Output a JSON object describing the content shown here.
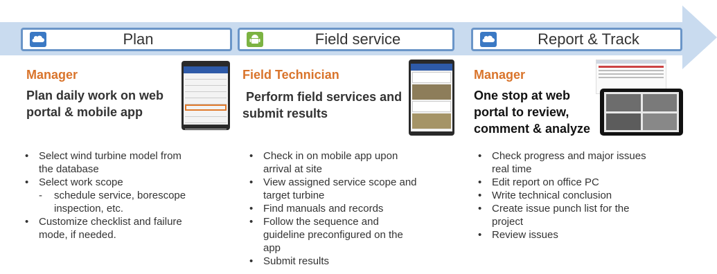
{
  "colors": {
    "accent": "#d9742b",
    "frame": "#6a95c8",
    "arrow": "#c9dbef"
  },
  "stages": [
    {
      "title": "Plan",
      "icon": "cloud-icon",
      "role": "Manager",
      "summary_lines": [
        "Plan daily work on web",
        "portal & mobile app"
      ],
      "bullets": [
        {
          "lines": [
            "Select wind turbine model from",
            "the database"
          ]
        },
        {
          "lines": [
            "Select work scope"
          ]
        },
        {
          "lines": [
            "schedule service, borescope",
            "inspection,  etc."
          ],
          "sub": true
        },
        {
          "lines": [
            "Customize checklist and failure",
            "mode, if needed."
          ]
        }
      ]
    },
    {
      "title": "Field service",
      "icon": "android-icon",
      "role": "Field Technician",
      "summary_lines": [
        " Perform field services and",
        "submit results"
      ],
      "bullets": [
        {
          "lines": [
            "Check in on mobile app upon",
            "arrival at site"
          ]
        },
        {
          "lines": [
            "View assigned service scope and",
            "target turbine"
          ]
        },
        {
          "lines": [
            "Find manuals and records"
          ]
        },
        {
          "lines": [
            "Follow the sequence and",
            "guideline preconfigured on the",
            "app"
          ]
        },
        {
          "lines": [
            "Submit results"
          ]
        }
      ]
    },
    {
      "title": "Report & Track",
      "icon": "cloud-icon",
      "role": "Manager",
      "summary_lines": [
        "One stop at web",
        "portal to review,",
        "comment & analyze"
      ],
      "bullets": [
        {
          "lines": [
            "Check progress and major issues",
            "real time"
          ]
        },
        {
          "lines": [
            "Edit report on office PC"
          ]
        },
        {
          "lines": [
            "Write technical conclusion"
          ]
        },
        {
          "lines": [
            "Create issue punch list for the",
            "project"
          ]
        },
        {
          "lines": [
            "Review issues"
          ]
        }
      ]
    }
  ]
}
